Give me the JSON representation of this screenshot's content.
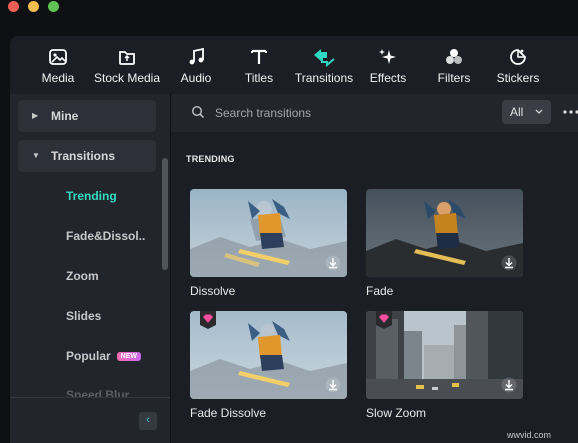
{
  "toolbar": {
    "items": [
      {
        "label": "Media",
        "icon": "media-icon"
      },
      {
        "label": "Stock Media",
        "icon": "stock-media-icon"
      },
      {
        "label": "Audio",
        "icon": "music-note-icon"
      },
      {
        "label": "Titles",
        "icon": "text-t-icon"
      },
      {
        "label": "Transitions",
        "icon": "transitions-arrows-icon",
        "active": true
      },
      {
        "label": "Effects",
        "icon": "sparkle-icon"
      },
      {
        "label": "Filters",
        "icon": "filter-circles-icon"
      },
      {
        "label": "Stickers",
        "icon": "sticker-icon"
      }
    ]
  },
  "sidebar": {
    "mine_label": "Mine",
    "transitions_label": "Transitions",
    "items": [
      {
        "label": "Trending",
        "active": true
      },
      {
        "label": "Fade&Dissol.."
      },
      {
        "label": "Zoom"
      },
      {
        "label": "Slides"
      },
      {
        "label": "Popular",
        "badge": "NEW"
      },
      {
        "label": "Speed Blur"
      }
    ],
    "collapse_icon": "chevron-left-icon"
  },
  "search": {
    "placeholder": "Search transitions",
    "filter_value": "All"
  },
  "content": {
    "section_title": "TRENDING",
    "cards": [
      {
        "label": "Dissolve",
        "premium": false
      },
      {
        "label": "Fade",
        "premium": false
      },
      {
        "label": "Fade Dissolve",
        "premium": true
      },
      {
        "label": "Slow Zoom",
        "premium": true
      }
    ]
  },
  "colors": {
    "accent": "#2fd8c2",
    "panel": "#22252c",
    "background": "#1c1e25"
  },
  "watermark": "wwvid.com"
}
